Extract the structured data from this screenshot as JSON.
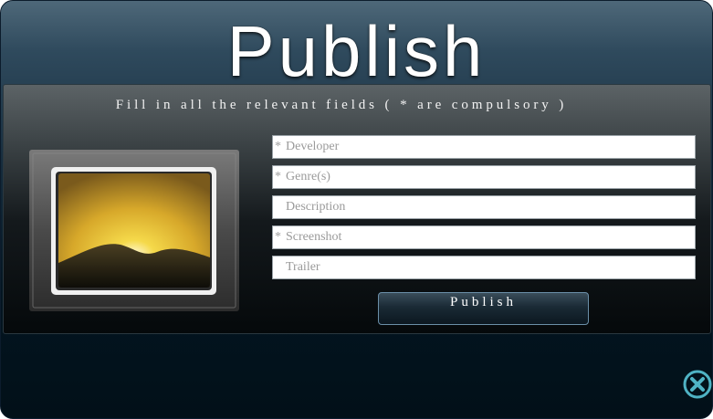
{
  "dialog": {
    "title": "Publish",
    "instructions": "Fill in all the relevant fields ( * are compulsory )"
  },
  "form": {
    "fields": [
      {
        "required": true,
        "marker": "*",
        "label": "Developer"
      },
      {
        "required": true,
        "marker": "*",
        "label": "Genre(s)"
      },
      {
        "required": false,
        "marker": "",
        "label": "Description"
      },
      {
        "required": true,
        "marker": "*",
        "label": "Screenshot"
      },
      {
        "required": false,
        "marker": "",
        "label": "Trailer"
      }
    ],
    "submit_label": "Publish"
  },
  "icons": {
    "preview": "image-placeholder-icon",
    "close": "close-icon"
  },
  "colors": {
    "accent": "#4fb3c4",
    "field_text": "#9a9a9a"
  }
}
